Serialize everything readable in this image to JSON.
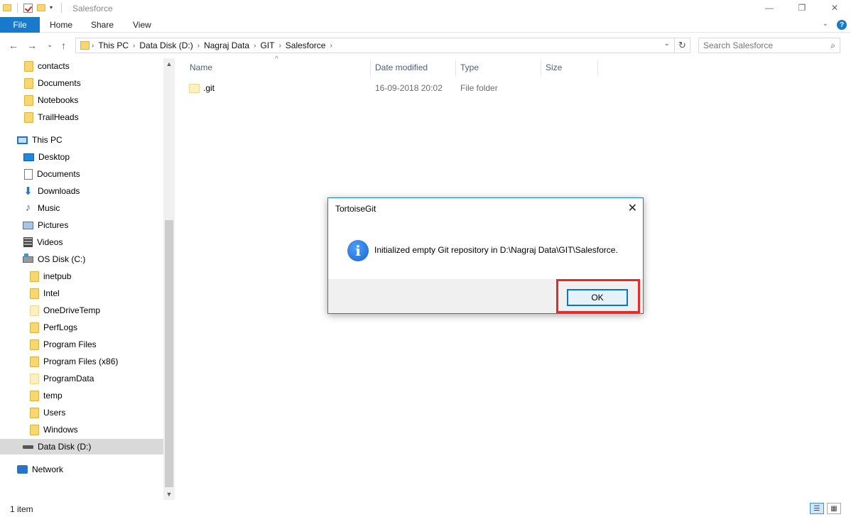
{
  "window": {
    "title": "Salesforce",
    "qat_dropdown": "▾",
    "minimize_glyph": "—",
    "restore_glyph": "❐",
    "close_glyph": "✕"
  },
  "ribbon": {
    "tabs": [
      "File",
      "Home",
      "Share",
      "View"
    ],
    "expand_glyph": "⌄",
    "help_glyph": "?"
  },
  "nav": {
    "back_glyph": "←",
    "forward_glyph": "→",
    "recent_glyph": "⌄",
    "up_glyph": "↑",
    "breadcrumb": [
      "This PC",
      "Data Disk (D:)",
      "Nagraj Data",
      "GIT",
      "Salesforce"
    ],
    "separator_glyph": "›",
    "address_dropdown_glyph": "⌄",
    "refresh_glyph": "↻",
    "search_placeholder": "Search Salesforce",
    "search_icon": "⌕"
  },
  "sidebar": {
    "quick_access": [
      "contacts",
      "Documents",
      "Notebooks",
      "TrailHeads"
    ],
    "this_pc": "This PC",
    "libraries": [
      "Desktop",
      "Documents",
      "Downloads",
      "Music",
      "Pictures",
      "Videos"
    ],
    "os_disk": "OS Disk (C:)",
    "os_folders": [
      "inetpub",
      "Intel",
      "OneDriveTemp",
      "PerfLogs",
      "Program Files",
      "Program Files (x86)",
      "ProgramData",
      "temp",
      "Users",
      "Windows"
    ],
    "data_disk": "Data Disk (D:)",
    "network": "Network",
    "scroll_up_glyph": "▲",
    "scroll_down_glyph": "▼"
  },
  "columns": {
    "name": "Name",
    "date_modified": "Date modified",
    "type": "Type",
    "size": "Size",
    "sort_glyph": "^"
  },
  "files": [
    {
      "name": ".git",
      "date_modified": "16-09-2018 20:02",
      "type": "File folder",
      "size": ""
    }
  ],
  "status": {
    "item_count": "1 item",
    "details_view_glyph": "☰",
    "tiles_view_glyph": "▦"
  },
  "dialog": {
    "title": "TortoiseGit",
    "close_glyph": "✕",
    "icon_glyph": "i",
    "message": "Initialized empty Git repository in D:\\Nagraj Data\\GIT\\Salesforce.",
    "ok_label": "OK",
    "highlight_color": "#e32b2b"
  }
}
